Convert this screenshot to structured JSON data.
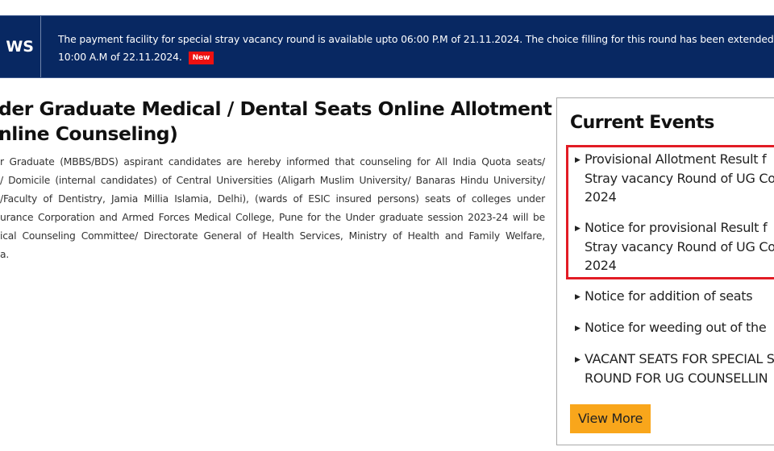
{
  "news": {
    "label": "WS",
    "line1": "The payment facility for special stray vacancy round is available upto 06:00 P.M of 21.11.2024. The choice filling for this round has been extended",
    "line2": "10:00 A.M of 22.11.2024.",
    "badge": "New",
    "badge_color": "#ee1111",
    "bar_color": "#082862"
  },
  "main": {
    "title_line1": "der Graduate Medical / Dental Seats Online Allotment",
    "title_line2": "nline Counseling)",
    "body_lines": [
      "r Graduate (MBBS/BDS) aspirant candidates are hereby informed that counseling for All India Quota seats/",
      "/ Domicile (internal candidates) of Central Universities (Aligarh Muslim University/ Banaras Hindu University/",
      "/Faculty of Dentistry, Jamia Millia Islamia, Delhi), (wards of ESIC insured persons) seats of colleges under",
      "urance Corporation and Armed Forces Medical College, Pune for the Under graduate session 2023-24 will be",
      "ical Counseling Committee/ Directorate General of Health Services, Ministry of Health and Family Welfare,",
      "a."
    ]
  },
  "events": {
    "title": "Current Events",
    "items": [
      {
        "lines": [
          "Provisional Allotment Result f",
          "Stray vacancy Round of UG Co",
          "2024"
        ],
        "highlighted": true
      },
      {
        "lines": [
          "Notice for provisional Result f",
          "Stray vacancy Round of UG Co",
          "2024"
        ],
        "highlighted": true
      },
      {
        "lines": [
          "Notice for addition of seats"
        ],
        "highlighted": false
      },
      {
        "lines": [
          "Notice for weeding out of the"
        ],
        "highlighted": false
      },
      {
        "lines": [
          "VACANT SEATS FOR SPECIAL S",
          "ROUND FOR UG COUNSELLIN"
        ],
        "highlighted": false
      }
    ],
    "view_more_label": "View More",
    "highlight_color": "#e21c25",
    "button_color": "#f9a61b"
  }
}
